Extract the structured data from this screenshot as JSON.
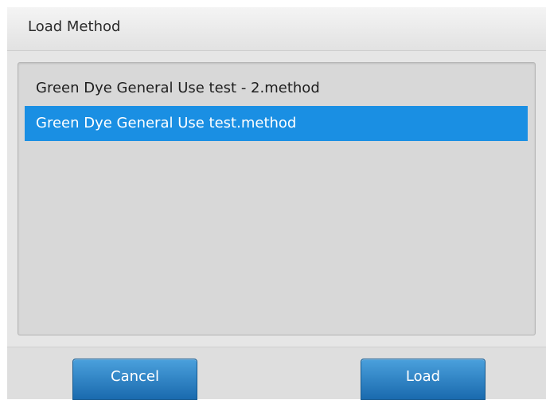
{
  "dialog": {
    "title": "Load Method"
  },
  "file_list": {
    "items": [
      {
        "label": "Green Dye General Use test - 2.method",
        "selected": false
      },
      {
        "label": "Green Dye General Use test.method",
        "selected": true
      }
    ]
  },
  "buttons": {
    "cancel_label": "Cancel",
    "load_label": "Load"
  },
  "colors": {
    "selection": "#1a8fe3",
    "button": "#2b7fc4"
  }
}
